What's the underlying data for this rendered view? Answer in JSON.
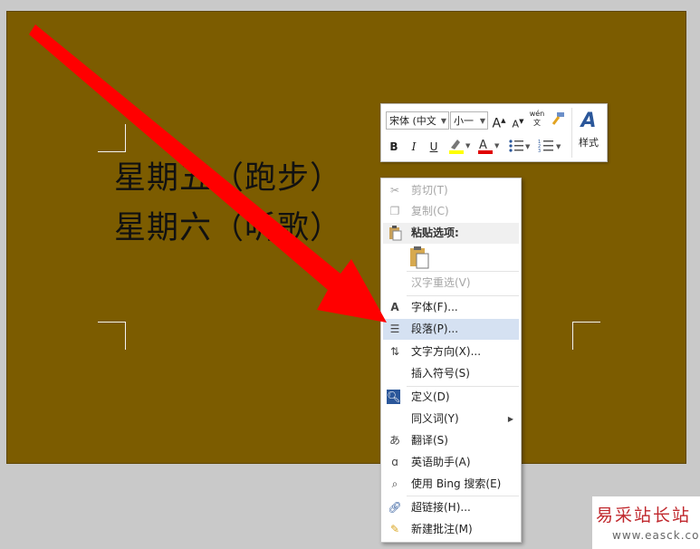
{
  "document": {
    "lines": [
      "星期五（跑步）",
      "星期六（听歌）"
    ]
  },
  "mini_toolbar": {
    "font_name": "宋体 (中文",
    "font_size": "小一",
    "grow_font_label": "A",
    "shrink_font_label": "A",
    "phonetic_label": "wén 文",
    "bold_label": "B",
    "italic_label": "I",
    "underline_label": "U",
    "font_color_label": "A",
    "styles_label": "样式"
  },
  "context_menu": {
    "items": [
      {
        "label": "剪切(T)",
        "icon": "scissors-icon",
        "disabled": true
      },
      {
        "label": "复制(C)",
        "icon": "copy-icon",
        "disabled": true
      },
      {
        "label": "汉字重选(V)",
        "disabled": true
      },
      {
        "label": "字体(F)...",
        "icon": "font-icon"
      },
      {
        "label": "段落(P)...",
        "icon": "paragraph-icon",
        "highlighted": true
      },
      {
        "label": "文字方向(X)...",
        "icon": "text-direction-icon"
      },
      {
        "label": "插入符号(S)"
      },
      {
        "label": "定义(D)",
        "icon": "define-icon"
      },
      {
        "label": "同义词(Y)",
        "has_submenu": true
      },
      {
        "label": "翻译(S)",
        "icon": "translate-icon"
      },
      {
        "label": "英语助手(A)",
        "icon": "english-assistant-icon"
      },
      {
        "label": "使用 Bing 搜索(E)",
        "icon": "search-icon"
      },
      {
        "label": "超链接(H)...",
        "icon": "hyperlink-icon"
      },
      {
        "label": "新建批注(M)",
        "icon": "new-comment-icon"
      }
    ],
    "paste_options_header": "粘贴选项:"
  },
  "watermark": {
    "title": "易采站长站",
    "url": "www.easck.com"
  },
  "colors": {
    "page_background": "#7c5c00",
    "arrow": "#ff0000",
    "menu_highlight": "#d5e1f2"
  }
}
